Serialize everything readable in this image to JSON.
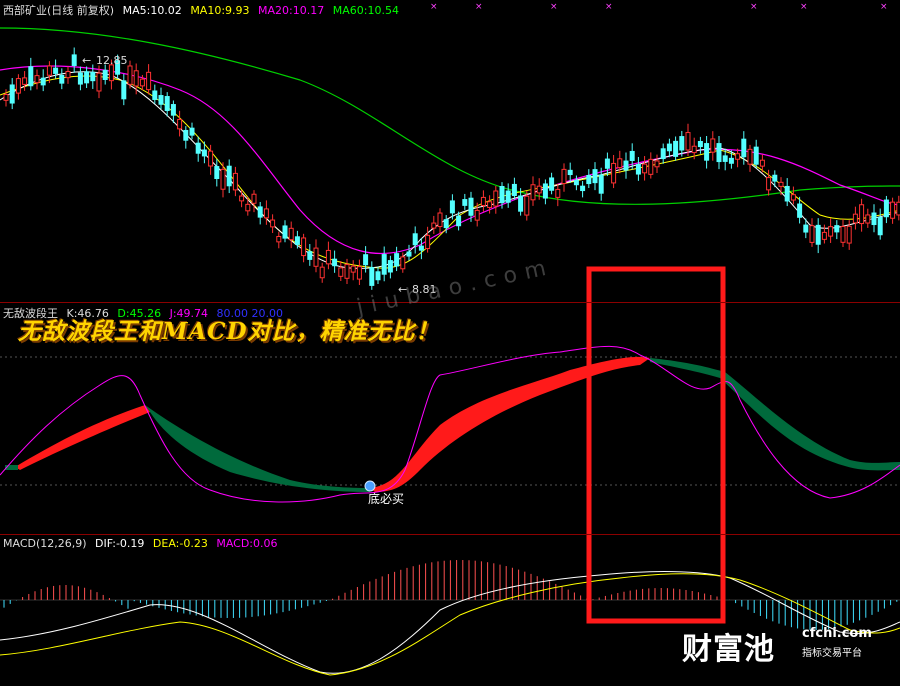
{
  "main_panel": {
    "stock_name": "西部矿业(日线 前复权)",
    "ma5": "MA5:10.02",
    "ma10": "MA10:9.93",
    "ma20": "MA20:10.17",
    "ma60": "MA60:10.54",
    "high_label": "12.85",
    "low_label": "8.81",
    "colors": {
      "up": "#ff3232",
      "down": "#54ffff",
      "ma5": "#ffffff",
      "ma10": "#ffff00",
      "ma20": "#ff00ff",
      "ma60": "#00ff00"
    }
  },
  "indicator_panel": {
    "name": "无敌波段王",
    "k": "K:46.76",
    "d": "D:45.26",
    "j": "J:49.74",
    "levels": "80.00  20.00",
    "signal_label": "底必买",
    "overlay_text": "无敌波段王和MACD对比，精准无比！"
  },
  "macd_panel": {
    "name": "MACD(12,26,9)",
    "dif": "DIF:-0.19",
    "dea": "DEA:-0.23",
    "macd": "MACD:0.06"
  },
  "watermark": "jiubao.com",
  "logo": {
    "name": "财富池",
    "site": "cfchi.com",
    "caption": "指标交易平台"
  }
}
